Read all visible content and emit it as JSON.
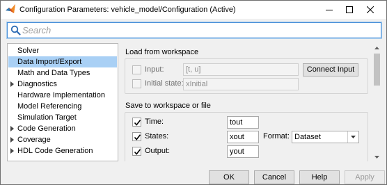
{
  "window": {
    "title": "Configuration Parameters: vehicle_model/Configuration (Active)"
  },
  "search": {
    "placeholder": "Search"
  },
  "tree": {
    "items": [
      {
        "label": "Solver",
        "expandable": false,
        "selected": false
      },
      {
        "label": "Data Import/Export",
        "expandable": false,
        "selected": true
      },
      {
        "label": "Math and Data Types",
        "expandable": false,
        "selected": false
      },
      {
        "label": "Diagnostics",
        "expandable": true,
        "selected": false
      },
      {
        "label": "Hardware Implementation",
        "expandable": false,
        "selected": false
      },
      {
        "label": "Model Referencing",
        "expandable": false,
        "selected": false
      },
      {
        "label": "Simulation Target",
        "expandable": false,
        "selected": false
      },
      {
        "label": "Code Generation",
        "expandable": true,
        "selected": false
      },
      {
        "label": "Coverage",
        "expandable": true,
        "selected": false
      },
      {
        "label": "HDL Code Generation",
        "expandable": true,
        "selected": false
      }
    ]
  },
  "load_section": {
    "title": "Load from workspace",
    "input": {
      "label": "Input:",
      "checked": false,
      "value": "[t, u]"
    },
    "initial_state": {
      "label": "Initial state:",
      "checked": false,
      "value": "xInitial"
    },
    "connect_button": "Connect Input"
  },
  "save_section": {
    "title": "Save to workspace or file",
    "time": {
      "label": "Time:",
      "checked": true,
      "value": "tout"
    },
    "states": {
      "label": "States:",
      "checked": true,
      "value": "xout"
    },
    "format": {
      "label": "Format:",
      "selected": "Dataset"
    },
    "output": {
      "label": "Output:",
      "checked": true,
      "value": "yout"
    }
  },
  "buttons": {
    "ok": "OK",
    "cancel": "Cancel",
    "help": "Help",
    "apply": "Apply"
  },
  "colors": {
    "selection": "#a9d0f5",
    "search_border": "#4a90d9",
    "app_icon": "#d9541e"
  }
}
